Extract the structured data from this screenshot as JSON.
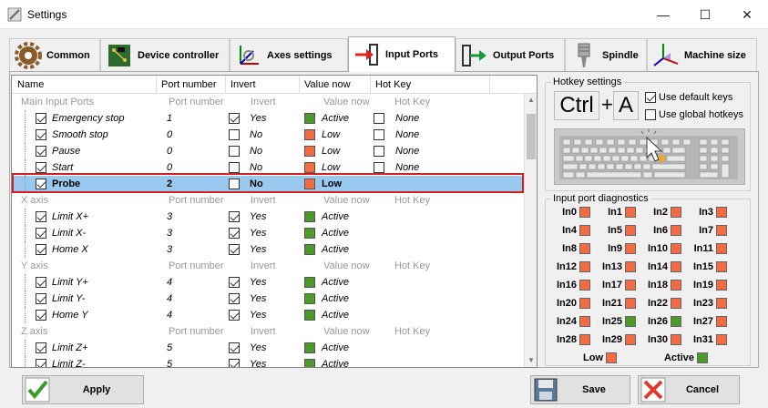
{
  "window": {
    "title": "Settings",
    "minimize": "—",
    "maximize": "☐",
    "close": "✕"
  },
  "tabs": [
    {
      "label": "Common",
      "icon": "gear-icon"
    },
    {
      "label": "Device controller",
      "icon": "circuit-board-icon"
    },
    {
      "label": "Axes settings",
      "icon": "axes-icon"
    },
    {
      "label": "Input Ports",
      "icon": "input-arrow-icon",
      "active": true
    },
    {
      "label": "Output Ports",
      "icon": "output-arrow-icon"
    },
    {
      "label": "Spindle",
      "icon": "spindle-icon"
    },
    {
      "label": "Machine size",
      "icon": "machine-size-icon"
    }
  ],
  "grid": {
    "headers": [
      "Name",
      "Port number",
      "Invert",
      "Value now",
      "Hot Key"
    ],
    "rows": [
      {
        "type": "group",
        "name": "Main Input Ports",
        "port": "Port number",
        "invert": "Invert",
        "value": "Value now",
        "hotkey": "Hot Key"
      },
      {
        "type": "item",
        "name": "Emergency stop",
        "port": "1",
        "invert": "Yes",
        "invertChecked": true,
        "value": "Active",
        "valueColor": "green",
        "hotkey": "None",
        "hk": true
      },
      {
        "type": "item",
        "name": "Smooth stop",
        "port": "0",
        "invert": "No",
        "invertChecked": false,
        "value": "Low",
        "valueColor": "red",
        "hotkey": "None",
        "hk": true
      },
      {
        "type": "item",
        "name": "Pause",
        "port": "0",
        "invert": "No",
        "invertChecked": false,
        "value": "Low",
        "valueColor": "red",
        "hotkey": "None",
        "hk": true
      },
      {
        "type": "item",
        "name": "Start",
        "port": "0",
        "invert": "No",
        "invertChecked": false,
        "value": "Low",
        "valueColor": "red",
        "hotkey": "None",
        "hk": true
      },
      {
        "type": "selected",
        "name": "Probe",
        "port": "2",
        "invert": "No",
        "invertChecked": false,
        "value": "Low",
        "valueColor": "red",
        "hotkey": "",
        "hk": false
      },
      {
        "type": "group",
        "name": "X axis",
        "port": "Port number",
        "invert": "Invert",
        "value": "Value now",
        "hotkey": "Hot Key"
      },
      {
        "type": "item",
        "name": "Limit X+",
        "port": "3",
        "invert": "Yes",
        "invertChecked": true,
        "value": "Active",
        "valueColor": "green",
        "hotkey": "",
        "hk": false
      },
      {
        "type": "item",
        "name": "Limit X-",
        "port": "3",
        "invert": "Yes",
        "invertChecked": true,
        "value": "Active",
        "valueColor": "green",
        "hotkey": "",
        "hk": false
      },
      {
        "type": "item",
        "name": "Home X",
        "port": "3",
        "invert": "Yes",
        "invertChecked": true,
        "value": "Active",
        "valueColor": "green",
        "hotkey": "",
        "hk": false
      },
      {
        "type": "group",
        "name": "Y axis",
        "port": "Port number",
        "invert": "Invert",
        "value": "Value now",
        "hotkey": "Hot Key"
      },
      {
        "type": "item",
        "name": "Limit Y+",
        "port": "4",
        "invert": "Yes",
        "invertChecked": true,
        "value": "Active",
        "valueColor": "green",
        "hotkey": "",
        "hk": false
      },
      {
        "type": "item",
        "name": "Limit Y-",
        "port": "4",
        "invert": "Yes",
        "invertChecked": true,
        "value": "Active",
        "valueColor": "green",
        "hotkey": "",
        "hk": false
      },
      {
        "type": "item",
        "name": "Home Y",
        "port": "4",
        "invert": "Yes",
        "invertChecked": true,
        "value": "Active",
        "valueColor": "green",
        "hotkey": "",
        "hk": false
      },
      {
        "type": "group",
        "name": "Z axis",
        "port": "Port number",
        "invert": "Invert",
        "value": "Value now",
        "hotkey": "Hot Key"
      },
      {
        "type": "item",
        "name": "Limit Z+",
        "port": "5",
        "invert": "Yes",
        "invertChecked": true,
        "value": "Active",
        "valueColor": "green",
        "hotkey": "",
        "hk": false
      },
      {
        "type": "item",
        "name": "Limit Z-",
        "port": "5",
        "invert": "Yes",
        "invertChecked": true,
        "value": "Active",
        "valueColor": "green",
        "hotkey": "",
        "hk": false
      }
    ]
  },
  "hotkey": {
    "title": "Hotkey settings",
    "key1": "Ctrl",
    "plus": "+",
    "key2": "A",
    "use_default": "Use default keys",
    "use_default_checked": true,
    "use_global": "Use global hotkeys",
    "use_global_checked": false
  },
  "diagnostics": {
    "title": "Input port diagnostics",
    "ports": [
      {
        "label": "In0",
        "state": "low"
      },
      {
        "label": "In1",
        "state": "low"
      },
      {
        "label": "In2",
        "state": "low"
      },
      {
        "label": "In3",
        "state": "low"
      },
      {
        "label": "In4",
        "state": "low"
      },
      {
        "label": "In5",
        "state": "low"
      },
      {
        "label": "In6",
        "state": "low"
      },
      {
        "label": "In7",
        "state": "low"
      },
      {
        "label": "In8",
        "state": "low"
      },
      {
        "label": "In9",
        "state": "low"
      },
      {
        "label": "In10",
        "state": "low"
      },
      {
        "label": "In11",
        "state": "low"
      },
      {
        "label": "In12",
        "state": "low"
      },
      {
        "label": "In13",
        "state": "low"
      },
      {
        "label": "In14",
        "state": "low"
      },
      {
        "label": "In15",
        "state": "low"
      },
      {
        "label": "In16",
        "state": "low"
      },
      {
        "label": "In17",
        "state": "low"
      },
      {
        "label": "In18",
        "state": "low"
      },
      {
        "label": "In19",
        "state": "low"
      },
      {
        "label": "In20",
        "state": "low"
      },
      {
        "label": "In21",
        "state": "low"
      },
      {
        "label": "In22",
        "state": "low"
      },
      {
        "label": "In23",
        "state": "low"
      },
      {
        "label": "In24",
        "state": "low"
      },
      {
        "label": "In25",
        "state": "active"
      },
      {
        "label": "In26",
        "state": "active"
      },
      {
        "label": "In27",
        "state": "low"
      },
      {
        "label": "In28",
        "state": "low"
      },
      {
        "label": "In29",
        "state": "low"
      },
      {
        "label": "In30",
        "state": "low"
      },
      {
        "label": "In31",
        "state": "low"
      }
    ],
    "legend_low": "Low",
    "legend_active": "Active"
  },
  "colors": {
    "low": "#f26b43",
    "active": "#4b9a2a",
    "selection": "#99c9ef",
    "highlight": "#d32020"
  },
  "buttons": {
    "apply": "Apply",
    "save": "Save",
    "cancel": "Cancel"
  }
}
